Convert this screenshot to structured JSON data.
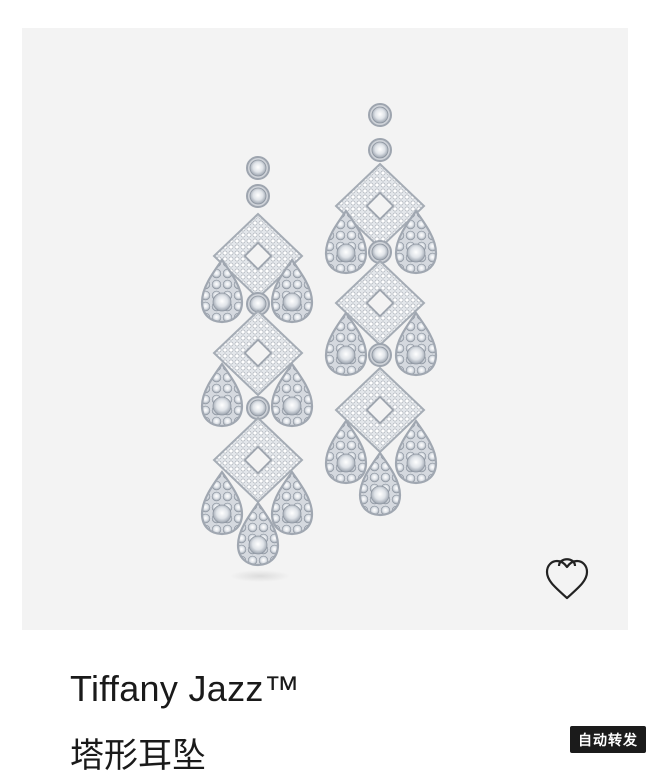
{
  "product": {
    "brand": "Tiffany Jazz™",
    "name": "塔形耳坠",
    "image_alt": "Tiffany Jazz chandelier diamond earrings"
  },
  "icons": {
    "wishlist": "heart-lock-icon"
  },
  "badge": {
    "label": "自动转发"
  },
  "colors": {
    "card_background": "#f3f3f3",
    "metal": "#c8ccd2",
    "text": "#1a1a1a",
    "badge_bg": "#1b1b1b"
  }
}
